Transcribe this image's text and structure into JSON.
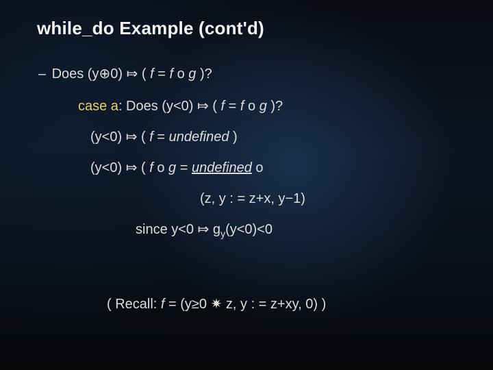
{
  "title": "while_do Example (cont'd)",
  "bullet": {
    "dash": "–",
    "t1": "Does (y",
    "sym1": "⊕",
    "t2": "0) ",
    "arrow": "⤇",
    "t3": " ( ",
    "f": "f",
    "eq": " = ",
    "f2": "f",
    "compose": " o ",
    "g": "g",
    "t4": " )?"
  },
  "case": {
    "label": "case a",
    "t1": ": Does (y<0) ",
    "arrow": "⤇",
    "t2": " ( ",
    "f": "f",
    "eq": " = ",
    "f2": "f",
    "compose": " o ",
    "g": "g",
    "t3": " )?"
  },
  "line1": {
    "t1": "(y<0) ",
    "arrow": "⤇",
    "t2": " ( ",
    "f": "f",
    "eq": " = ",
    "undef": "undefined",
    "t3": " )"
  },
  "line2": {
    "t1": "(y<0) ",
    "arrow": "⤇",
    "t2": " ( ",
    "f": "f",
    "compose": " o ",
    "g": "g",
    "eq": " = ",
    "undef": "undefined",
    "comp2": " o"
  },
  "line2b": "(z, y : = z+x, y−1)",
  "since": {
    "t1": "since y<0 ",
    "arrow": "⤇",
    "t2": " g",
    "sub": "y",
    "t3": "(y<0)<0"
  },
  "recall": {
    "t1": "( Recall: ",
    "f": "f",
    "t2": " = (y≥0 ",
    "star": "✷",
    "t3": " z, y : = z+xy, 0) )"
  }
}
